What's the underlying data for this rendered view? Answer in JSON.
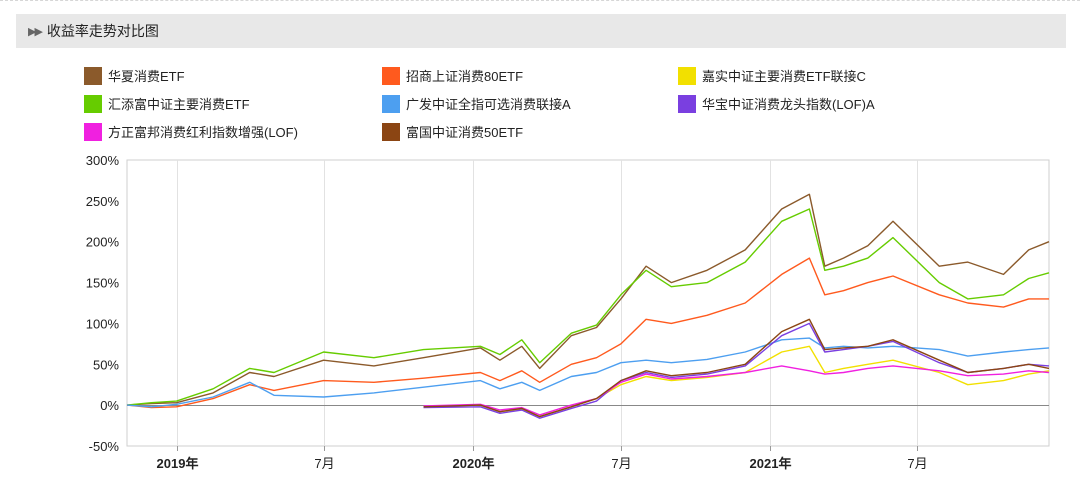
{
  "section": {
    "title": "收益率走势对比图"
  },
  "colors": {
    "华夏消费ETF": "#8b5a2b",
    "招商上证消费80ETF": "#ff5a1e",
    "嘉实中证主要消费ETF联接C": "#f2e000",
    "汇添富中证主要消费ETF": "#66cc00",
    "广发中证全指可选消费联接A": "#4d9ff0",
    "华宝中证消费龙头指数(LOF)A": "#7a3fe0",
    "方正富邦消费红利指数增强(LOF)": "#f020e0",
    "富国中证消费50ETF": "#8b4513"
  },
  "chart_data": {
    "type": "line",
    "title": "收益率走势对比图",
    "xlabel": "",
    "ylabel": "",
    "x_range": [
      "2018-11-01",
      "2021-12-10"
    ],
    "ylim": [
      -50,
      300
    ],
    "y_ticks": [
      -50,
      0,
      50,
      100,
      150,
      200,
      250,
      300
    ],
    "y_tick_labels": [
      "-50%",
      "0%",
      "50%",
      "100%",
      "150%",
      "200%",
      "250%",
      "300%"
    ],
    "x_ticks": [
      {
        "date": "2019-01-01",
        "label": "2019年",
        "major": true
      },
      {
        "date": "2019-07-01",
        "label": "7月",
        "major": false
      },
      {
        "date": "2020-01-01",
        "label": "2020年",
        "major": true
      },
      {
        "date": "2020-07-01",
        "label": "7月",
        "major": false
      },
      {
        "date": "2021-01-01",
        "label": "2021年",
        "major": true
      },
      {
        "date": "2021-07-01",
        "label": "7月",
        "major": false
      }
    ],
    "grid": "vertical",
    "legend_position": "top",
    "series": [
      {
        "name": "华夏消费ETF",
        "x": [
          "2018-11-01",
          "2018-12-01",
          "2019-01-01",
          "2019-02-15",
          "2019-04-01",
          "2019-05-01",
          "2019-07-01",
          "2019-09-01",
          "2019-11-01",
          "2020-01-10",
          "2020-02-03",
          "2020-03-01",
          "2020-03-23",
          "2020-05-01",
          "2020-06-01",
          "2020-07-01",
          "2020-08-01",
          "2020-09-01",
          "2020-10-15",
          "2020-12-01",
          "2021-01-15",
          "2021-02-18",
          "2021-03-09",
          "2021-04-01",
          "2021-05-01",
          "2021-06-01",
          "2021-07-28",
          "2021-09-01",
          "2021-10-15",
          "2021-11-15",
          "2021-12-10"
        ],
        "values": [
          0,
          2,
          3,
          15,
          40,
          35,
          55,
          48,
          58,
          70,
          55,
          72,
          45,
          85,
          95,
          130,
          170,
          150,
          165,
          190,
          240,
          258,
          170,
          180,
          195,
          225,
          170,
          175,
          160,
          190,
          200
        ]
      },
      {
        "name": "招商上证消费80ETF",
        "x": [
          "2018-11-01",
          "2018-12-01",
          "2019-01-01",
          "2019-02-15",
          "2019-04-01",
          "2019-05-01",
          "2019-07-01",
          "2019-09-01",
          "2019-11-01",
          "2020-01-10",
          "2020-02-03",
          "2020-03-01",
          "2020-03-23",
          "2020-05-01",
          "2020-06-01",
          "2020-07-01",
          "2020-08-01",
          "2020-09-01",
          "2020-10-15",
          "2020-12-01",
          "2021-01-15",
          "2021-02-18",
          "2021-03-09",
          "2021-04-01",
          "2021-05-01",
          "2021-06-01",
          "2021-07-28",
          "2021-09-01",
          "2021-10-15",
          "2021-11-15",
          "2021-12-10"
        ],
        "values": [
          0,
          -3,
          -2,
          8,
          25,
          18,
          30,
          28,
          33,
          40,
          30,
          42,
          28,
          50,
          58,
          75,
          105,
          100,
          110,
          125,
          160,
          180,
          135,
          140,
          150,
          158,
          135,
          125,
          120,
          130,
          130
        ]
      },
      {
        "name": "嘉实中证主要消费ETF联接C",
        "x": [
          "2019-11-01",
          "2020-01-10",
          "2020-02-03",
          "2020-03-01",
          "2020-03-23",
          "2020-05-01",
          "2020-06-01",
          "2020-07-01",
          "2020-08-01",
          "2020-09-01",
          "2020-10-15",
          "2020-12-01",
          "2021-01-15",
          "2021-02-18",
          "2021-03-09",
          "2021-04-01",
          "2021-05-01",
          "2021-06-01",
          "2021-07-28",
          "2021-09-01",
          "2021-10-15",
          "2021-11-15",
          "2021-12-10"
        ],
        "values": [
          -2,
          0,
          -8,
          -5,
          -14,
          -2,
          8,
          25,
          35,
          30,
          34,
          40,
          65,
          72,
          40,
          45,
          50,
          55,
          40,
          25,
          30,
          38,
          42
        ]
      },
      {
        "name": "汇添富中证主要消费ETF",
        "x": [
          "2018-11-01",
          "2018-12-01",
          "2019-01-01",
          "2019-02-15",
          "2019-04-01",
          "2019-05-01",
          "2019-07-01",
          "2019-09-01",
          "2019-11-01",
          "2020-01-10",
          "2020-02-03",
          "2020-03-01",
          "2020-03-23",
          "2020-05-01",
          "2020-06-01",
          "2020-07-01",
          "2020-08-01",
          "2020-09-01",
          "2020-10-15",
          "2020-12-01",
          "2021-01-15",
          "2021-02-18",
          "2021-03-09",
          "2021-04-01",
          "2021-05-01",
          "2021-06-01",
          "2021-07-28",
          "2021-09-01",
          "2021-10-15",
          "2021-11-15",
          "2021-12-10"
        ],
        "values": [
          0,
          3,
          5,
          20,
          45,
          40,
          65,
          58,
          68,
          72,
          62,
          80,
          52,
          88,
          98,
          135,
          165,
          145,
          150,
          175,
          225,
          240,
          165,
          170,
          180,
          205,
          150,
          130,
          135,
          155,
          162
        ]
      },
      {
        "name": "广发中证全指可选消费联接A",
        "x": [
          "2018-11-01",
          "2018-12-01",
          "2019-01-01",
          "2019-02-15",
          "2019-04-01",
          "2019-05-01",
          "2019-07-01",
          "2019-09-01",
          "2019-11-01",
          "2020-01-10",
          "2020-02-03",
          "2020-03-01",
          "2020-03-23",
          "2020-05-01",
          "2020-06-01",
          "2020-07-01",
          "2020-08-01",
          "2020-09-01",
          "2020-10-15",
          "2020-12-01",
          "2021-01-15",
          "2021-02-18",
          "2021-03-09",
          "2021-04-01",
          "2021-05-01",
          "2021-06-01",
          "2021-07-28",
          "2021-09-01",
          "2021-10-15",
          "2021-11-15",
          "2021-12-10"
        ],
        "values": [
          0,
          -2,
          1,
          10,
          28,
          12,
          10,
          15,
          22,
          30,
          20,
          28,
          18,
          35,
          40,
          52,
          55,
          52,
          56,
          65,
          80,
          82,
          70,
          72,
          70,
          72,
          68,
          60,
          65,
          68,
          70
        ]
      },
      {
        "name": "华宝中证消费龙头指数(LOF)A",
        "x": [
          "2019-11-01",
          "2020-01-10",
          "2020-02-03",
          "2020-03-01",
          "2020-03-23",
          "2020-05-01",
          "2020-06-01",
          "2020-07-01",
          "2020-08-01",
          "2020-09-01",
          "2020-10-15",
          "2020-12-01",
          "2021-01-15",
          "2021-02-18",
          "2021-03-09",
          "2021-04-01",
          "2021-05-01",
          "2021-06-01",
          "2021-07-28",
          "2021-09-01",
          "2021-10-15",
          "2021-11-15",
          "2021-12-10"
        ],
        "values": [
          -3,
          -2,
          -10,
          -6,
          -16,
          -4,
          5,
          30,
          40,
          34,
          38,
          48,
          85,
          100,
          65,
          68,
          72,
          78,
          52,
          40,
          45,
          50,
          48
        ]
      },
      {
        "name": "方正富邦消费红利指数增强(LOF)",
        "x": [
          "2019-11-01",
          "2020-01-10",
          "2020-02-03",
          "2020-03-01",
          "2020-03-23",
          "2020-05-01",
          "2020-06-01",
          "2020-07-01",
          "2020-08-01",
          "2020-09-01",
          "2020-10-15",
          "2020-12-01",
          "2021-01-15",
          "2021-02-18",
          "2021-03-09",
          "2021-04-01",
          "2021-05-01",
          "2021-06-01",
          "2021-07-28",
          "2021-09-01",
          "2021-10-15",
          "2021-11-15",
          "2021-12-10"
        ],
        "values": [
          -1,
          1,
          -6,
          -3,
          -12,
          0,
          8,
          28,
          38,
          32,
          35,
          40,
          48,
          42,
          38,
          40,
          45,
          48,
          42,
          36,
          38,
          42,
          40
        ]
      },
      {
        "name": "富国中证消费50ETF",
        "x": [
          "2019-11-01",
          "2020-01-10",
          "2020-02-03",
          "2020-03-01",
          "2020-03-23",
          "2020-05-01",
          "2020-06-01",
          "2020-07-01",
          "2020-08-01",
          "2020-09-01",
          "2020-10-15",
          "2020-12-01",
          "2021-01-15",
          "2021-02-18",
          "2021-03-09",
          "2021-04-01",
          "2021-05-01",
          "2021-06-01",
          "2021-07-28",
          "2021-09-01",
          "2021-10-15",
          "2021-11-15",
          "2021-12-10"
        ],
        "values": [
          -2,
          0,
          -8,
          -4,
          -14,
          -2,
          8,
          30,
          42,
          36,
          40,
          50,
          90,
          105,
          68,
          70,
          72,
          80,
          55,
          40,
          45,
          50,
          45
        ]
      }
    ]
  }
}
